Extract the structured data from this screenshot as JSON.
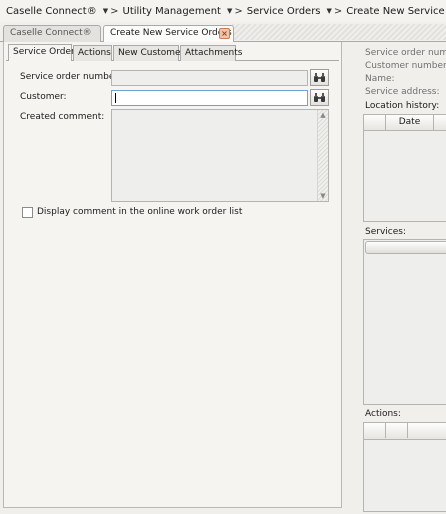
{
  "breadcrumb": {
    "items": [
      "Caselle Connect®",
      "Utility Management",
      "Service Orders",
      "Create New Service Orders"
    ],
    "separator": ">",
    "dropdown_glyph": "▼"
  },
  "outer_tabs": [
    {
      "label": "Caselle Connect®",
      "active": false
    },
    {
      "label": "Create New Service Orders",
      "active": true
    }
  ],
  "close_glyph": "×",
  "inner_tabs": [
    {
      "label": "Service Order",
      "active": true
    },
    {
      "label": "Actions",
      "active": false
    },
    {
      "label": "New Customer",
      "active": false
    },
    {
      "label": "Attachments",
      "active": false
    }
  ],
  "form": {
    "service_order_label": "Service order number:",
    "service_order_value": "",
    "customer_label": "Customer:",
    "customer_value": "",
    "created_comment_label": "Created comment:",
    "created_comment_value": "",
    "display_comment_label": "Display comment in the online work order list",
    "display_comment_checked": false
  },
  "summary": {
    "service_order_label": "Service order number",
    "customer_label": "Customer number:",
    "name_label": "Name:",
    "address_label": "Service address:",
    "location_history_label": "Location history:",
    "location_history_columns": [
      "",
      "Date"
    ],
    "services_label": "Services:",
    "actions_label": "Actions:"
  },
  "colors": {
    "accent_focus": "#6fa3d8",
    "close_icon": "#f3c3a8"
  }
}
